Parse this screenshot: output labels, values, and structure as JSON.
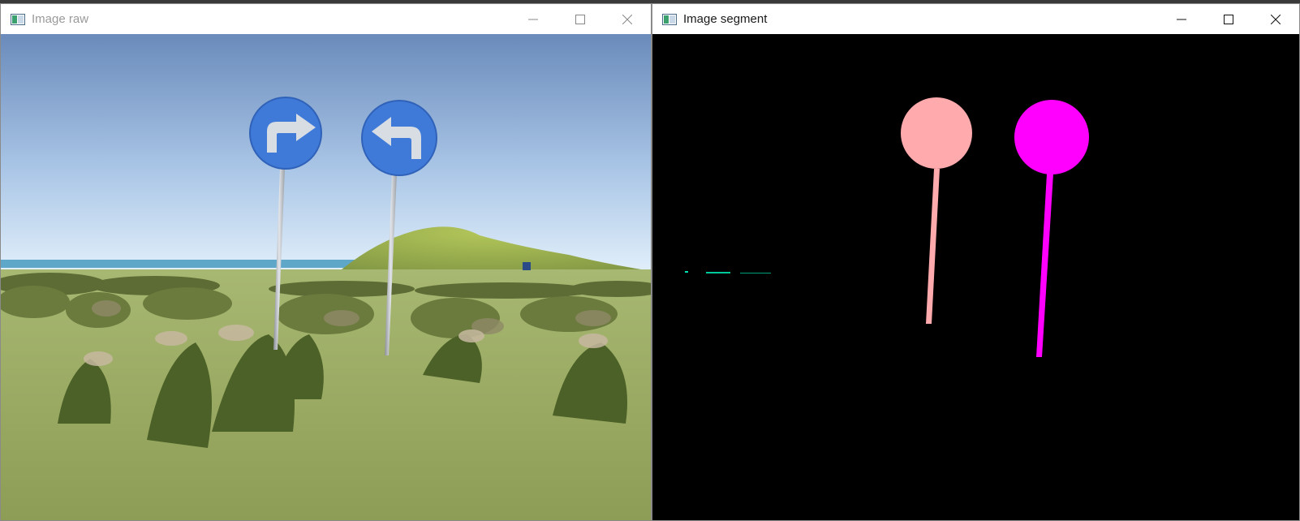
{
  "windows": [
    {
      "title": "Image raw",
      "icon": "opencv-window-icon",
      "title_color": "#9a9a9a"
    },
    {
      "title": "Image segment",
      "icon": "opencv-window-icon",
      "title_color": "#1a1a1a"
    }
  ],
  "controls": {
    "minimize": "minimize-icon",
    "maximize": "maximize-icon",
    "close": "close-icon"
  },
  "raw_scene": {
    "sky_top": "#6a8bbb",
    "sky_horizon": "#dfeefa",
    "grass": "#97a85c",
    "sign_color": "#3f7ad9",
    "arrow_color": "#d8dde3",
    "signs": [
      "turn-right-arrow-sign",
      "turn-left-arrow-sign"
    ]
  },
  "segment_scene": {
    "background": "#000000",
    "left_sign_color": "#ffaaad",
    "right_sign_color": "#ff00ff",
    "line_color": "#00e0b0"
  }
}
